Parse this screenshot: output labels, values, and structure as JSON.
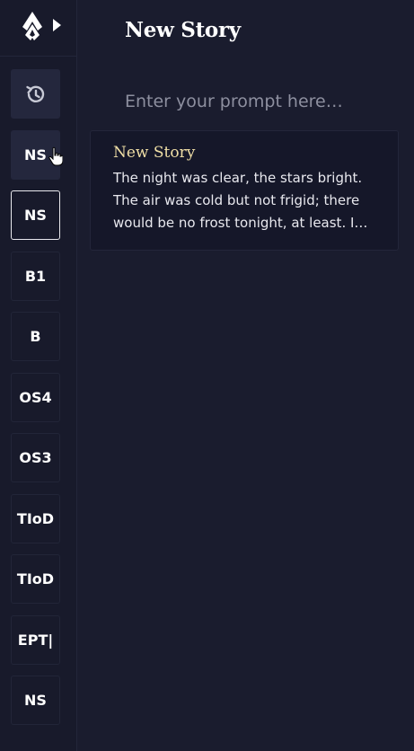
{
  "sidebar": {
    "history_icon": "history-icon",
    "stories": [
      {
        "label": "NS",
        "state": "hover"
      },
      {
        "label": "NS",
        "state": "selected"
      },
      {
        "label": "B1",
        "state": "normal"
      },
      {
        "label": "B",
        "state": "normal"
      },
      {
        "label": "OS4",
        "state": "normal"
      },
      {
        "label": "OS3",
        "state": "normal"
      },
      {
        "label": "TIoD",
        "state": "normal"
      },
      {
        "label": "TIoD",
        "state": "normal"
      },
      {
        "label": "EPT|",
        "state": "normal"
      },
      {
        "label": "NS",
        "state": "normal"
      }
    ]
  },
  "main": {
    "title": "New Story",
    "prompt_placeholder": "Enter your prompt here…",
    "results": [
      {
        "title": "New Story",
        "excerpt": "The night was clear, the stars bright. The air was cold but not frigid; there would be no frost tonight, at least. I shivered …"
      }
    ]
  },
  "colors": {
    "background": "#1a1c2e",
    "sidebar": "#181a2b",
    "card_title": "#f0dfa6",
    "placeholder": "#8d8f9f"
  }
}
